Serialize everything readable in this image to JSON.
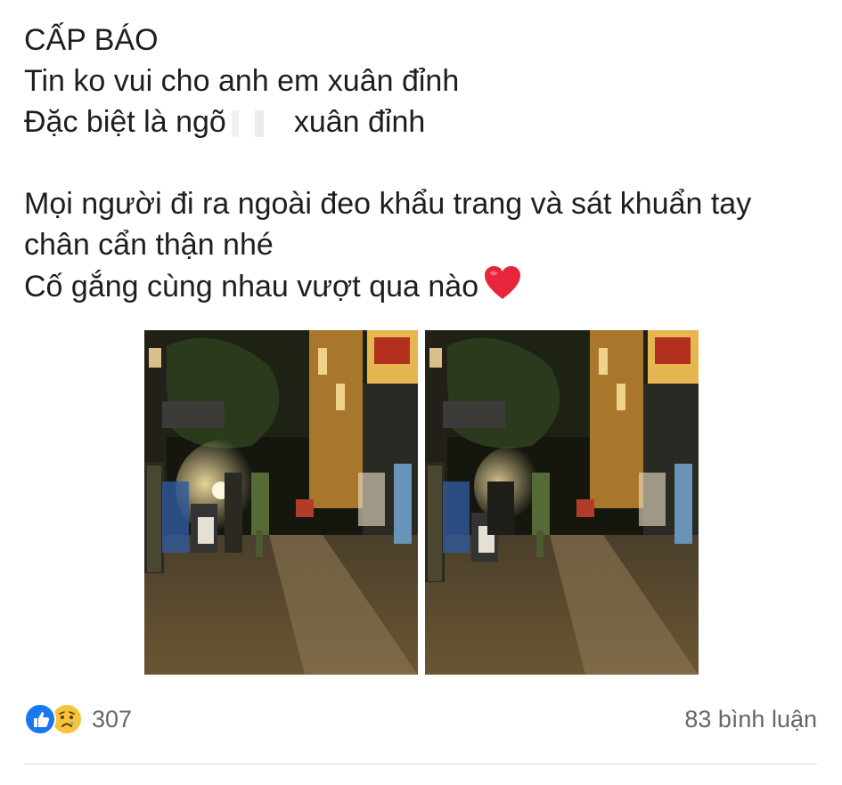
{
  "post": {
    "lines": [
      "CẤP BÁO",
      "Tin ko vui cho anh em xuân đỉnh",
      "Đặc biệt là ngõ",
      "xuân đỉnh",
      "Mọi người đi ra ngoài đeo khẩu trang và sát khuẩn tay",
      "chân cẩn thận nhé",
      "Cố gắng cùng nhau vượt qua nào"
    ],
    "emoji": "red-heart-icon"
  },
  "photos": [
    {
      "name": "street-night-photo-1"
    },
    {
      "name": "street-night-photo-2"
    }
  ],
  "footer": {
    "reaction_icons": [
      "like-icon",
      "sad-icon"
    ],
    "reaction_count": "307",
    "comment_count": "83 bình luận"
  },
  "colors": {
    "text": "#1c1e21",
    "meta": "#65676b",
    "like_blue": "#1877f2",
    "sad_yellow": "#f7c33b",
    "heart_red": "#e8263b"
  }
}
